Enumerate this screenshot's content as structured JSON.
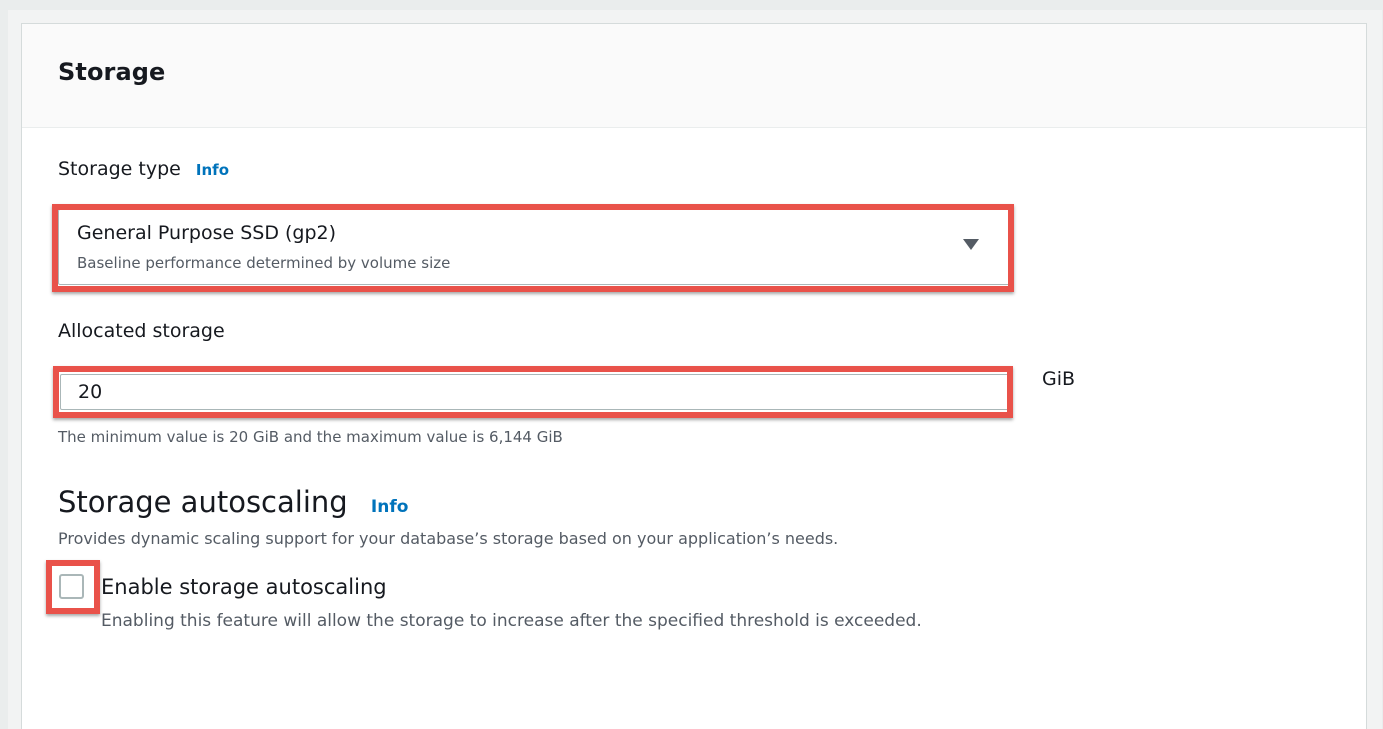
{
  "section": {
    "title": "Storage"
  },
  "storage_type": {
    "label": "Storage type",
    "info_link": "Info",
    "selected_value": "General Purpose SSD (gp2)",
    "selected_description": "Baseline performance determined by volume size"
  },
  "allocated_storage": {
    "label": "Allocated storage",
    "value": "20",
    "unit": "GiB",
    "hint": "The minimum value is 20 GiB and the maximum value is 6,144 GiB"
  },
  "autoscaling": {
    "title": "Storage autoscaling",
    "info_link": "Info",
    "description": "Provides dynamic scaling support for your database’s storage based on your application’s needs.",
    "checkbox_label": "Enable storage autoscaling",
    "checkbox_checked": false,
    "checkbox_description": "Enabling this feature will allow the storage to increase after the specified threshold is exceeded."
  },
  "colors": {
    "highlight": "#e9524a",
    "link": "#0073bb",
    "text": "#16191f",
    "secondary_text": "#545b64"
  }
}
